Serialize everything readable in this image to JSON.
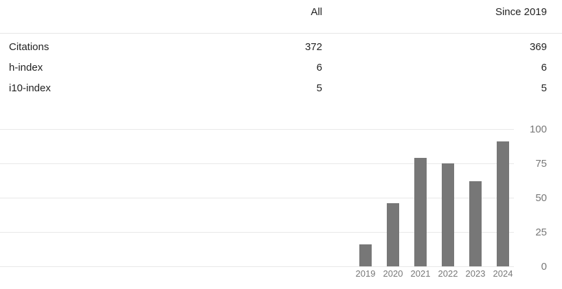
{
  "table": {
    "headers": [
      "",
      "All",
      "Since 2019"
    ],
    "rows": [
      {
        "label": "Citations",
        "all": "372",
        "since": "369"
      },
      {
        "label": "h-index",
        "all": "6",
        "since": "6"
      },
      {
        "label": "i10-index",
        "all": "5",
        "since": "5"
      }
    ]
  },
  "chart_data": {
    "type": "bar",
    "categories": [
      "2019",
      "2020",
      "2021",
      "2022",
      "2023",
      "2024"
    ],
    "values": [
      16,
      46,
      79,
      75,
      62,
      91
    ],
    "ylim": [
      0,
      100
    ],
    "yticks": [
      0,
      25,
      50,
      75,
      100
    ],
    "grid": true,
    "bar_color": "#777777",
    "title": "",
    "xlabel": "",
    "ylabel": ""
  }
}
